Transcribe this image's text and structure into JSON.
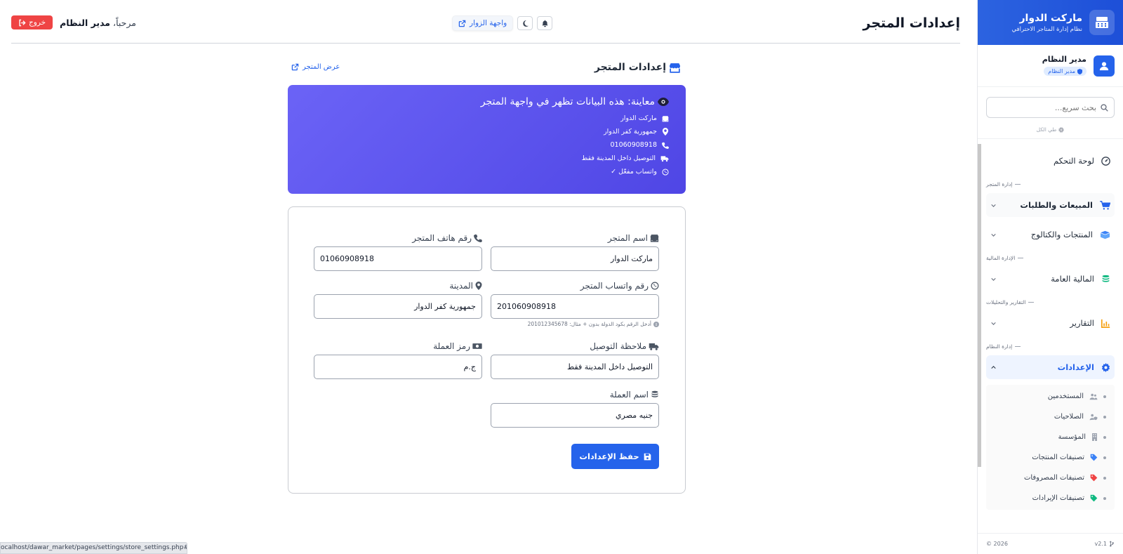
{
  "sidebar": {
    "brand_name": "ماركت الدوار",
    "brand_sub": "نظام إدارة المتاجر الاحترافي",
    "user_name": "مدير النظام",
    "user_role": "مدير النظام",
    "search_placeholder": "بحث سريع...",
    "collapse_all": "طي الكل",
    "dashboard": "لوحة التحكم",
    "section_store": "إدارة المتجر",
    "sales": "المبيعات والطلبات",
    "products": "المنتجات والكتالوج",
    "section_finance": "الإدارة المالية",
    "finance": "المالية العامة",
    "section_reports": "التقارير والتحليلات",
    "reports": "التقارير",
    "section_system": "إدارة النظام",
    "settings": "الإعدادات",
    "sub_items": [
      {
        "label": "المستخدمين",
        "icon": "users-icon",
        "color": "#9ca3af"
      },
      {
        "label": "الصلاحيات",
        "icon": "user-shield-icon",
        "color": "#9ca3af"
      },
      {
        "label": "المؤسسة",
        "icon": "building-icon",
        "color": "#9ca3af"
      },
      {
        "label": "تصنيفات المنتجات",
        "icon": "tag-icon",
        "color": "#3b82f6"
      },
      {
        "label": "تصنيفات المصروفات",
        "icon": "tag-icon",
        "color": "#ef4444"
      },
      {
        "label": "تصنيفات الإيرادات",
        "icon": "tag-icon",
        "color": "#10b981"
      }
    ],
    "version": "v2.1",
    "copyright": "2026 ©"
  },
  "topbar": {
    "title": "إعدادات المتجر",
    "visitor_link": "واجهة الزوار",
    "welcome_prefix": "مرحباً،",
    "welcome_name": "مدير النظام",
    "logout": "خروج"
  },
  "page": {
    "title": "إعدادات المتجر",
    "view_store": "عرض المتجر"
  },
  "preview": {
    "title": "معاينة: هذه البيانات تظهر في واجهة المتجر",
    "store_name": "ماركت الدوار",
    "city": "جمهورية كفر الدوار",
    "phone": "01060908918",
    "delivery": "التوصيل داخل المدينة فقط",
    "whatsapp": "واتساب مفعّل ✓"
  },
  "form": {
    "store_name_label": "اسم المتجر",
    "store_name_value": "ماركت الدوار",
    "phone_label": "رقم هاتف المتجر",
    "phone_value": "01060908918",
    "whatsapp_label": "رقم واتساب المتجر",
    "whatsapp_value": "201060908918",
    "whatsapp_hint": "أدخل الرقم بكود الدولة بدون + مثال: 201012345678",
    "city_label": "المدينة",
    "city_value": "جمهورية كفر الدوار",
    "delivery_label": "ملاحظة التوصيل",
    "delivery_value": "التوصيل داخل المدينة فقط",
    "currency_symbol_label": "رمز العملة",
    "currency_symbol_value": "ج.م",
    "currency_name_label": "اسم العملة",
    "currency_name_value": "جنيه مصري",
    "save": "حفظ الإعدادات"
  },
  "statusbar": "ocalhost/dawar_market/pages/settings/store_settings.php#",
  "colors": {
    "primary": "#2563eb",
    "danger": "#ef4444",
    "preview_gradient_start": "#6b63f6",
    "preview_gradient_end": "#4f46e5"
  }
}
